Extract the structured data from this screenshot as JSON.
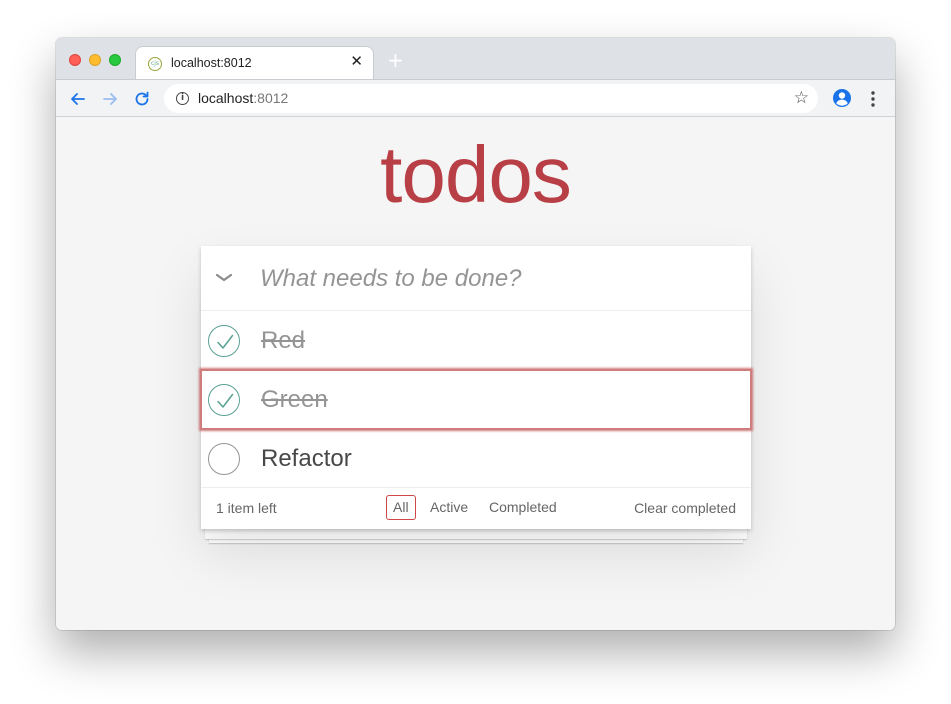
{
  "browser": {
    "tab_title": "localhost:8012",
    "tab_favicon": "cjs",
    "close_glyph": "✕",
    "new_tab_glyph": "+",
    "url_host": "localhost",
    "url_port": ":8012",
    "info_glyph": "i",
    "star_glyph": "☆",
    "icons": {
      "back": "arrow-left-icon",
      "forward": "arrow-right-icon",
      "reload": "reload-icon",
      "profile": "profile-icon",
      "menu": "kebab-menu-icon"
    },
    "colors": {
      "accent": "#1a73e8",
      "tab_bar": "#dee1e6"
    }
  },
  "app": {
    "title": "todos",
    "title_color": "#b83f45",
    "new_todo_placeholder": "What needs to be done?",
    "todos": [
      {
        "label": "Red",
        "completed": true,
        "editing": false
      },
      {
        "label": "Green",
        "completed": true,
        "editing": true
      },
      {
        "label": "Refactor",
        "completed": false,
        "editing": false
      }
    ],
    "footer": {
      "count_text": "1 item left",
      "filters": [
        "All",
        "Active",
        "Completed"
      ],
      "selected_filter": "All",
      "clear_label": "Clear completed"
    },
    "colors": {
      "check": "#59a193",
      "filter_border": "#ce4646",
      "edit_outline": "#cf7d7d"
    }
  }
}
